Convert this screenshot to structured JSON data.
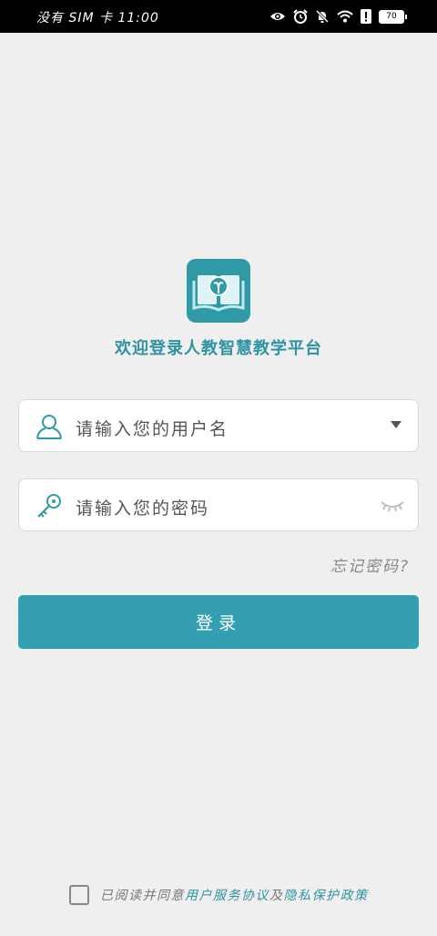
{
  "statusbar": {
    "text": "没有 SIM 卡 11:00",
    "battery": "70"
  },
  "app": {
    "welcome": "欢迎登录人教智慧教学平台"
  },
  "form": {
    "username_placeholder": "请输入您的用户名",
    "password_placeholder": "请输入您的密码",
    "forgot": "忘记密码?",
    "login": "登录"
  },
  "agreement": {
    "prefix": "已阅读并同意",
    "link1": "用户服务协议",
    "join": "及",
    "link2": "隐私保护政策"
  },
  "colors": {
    "accent": "#349eb3",
    "background": "#efefef"
  }
}
